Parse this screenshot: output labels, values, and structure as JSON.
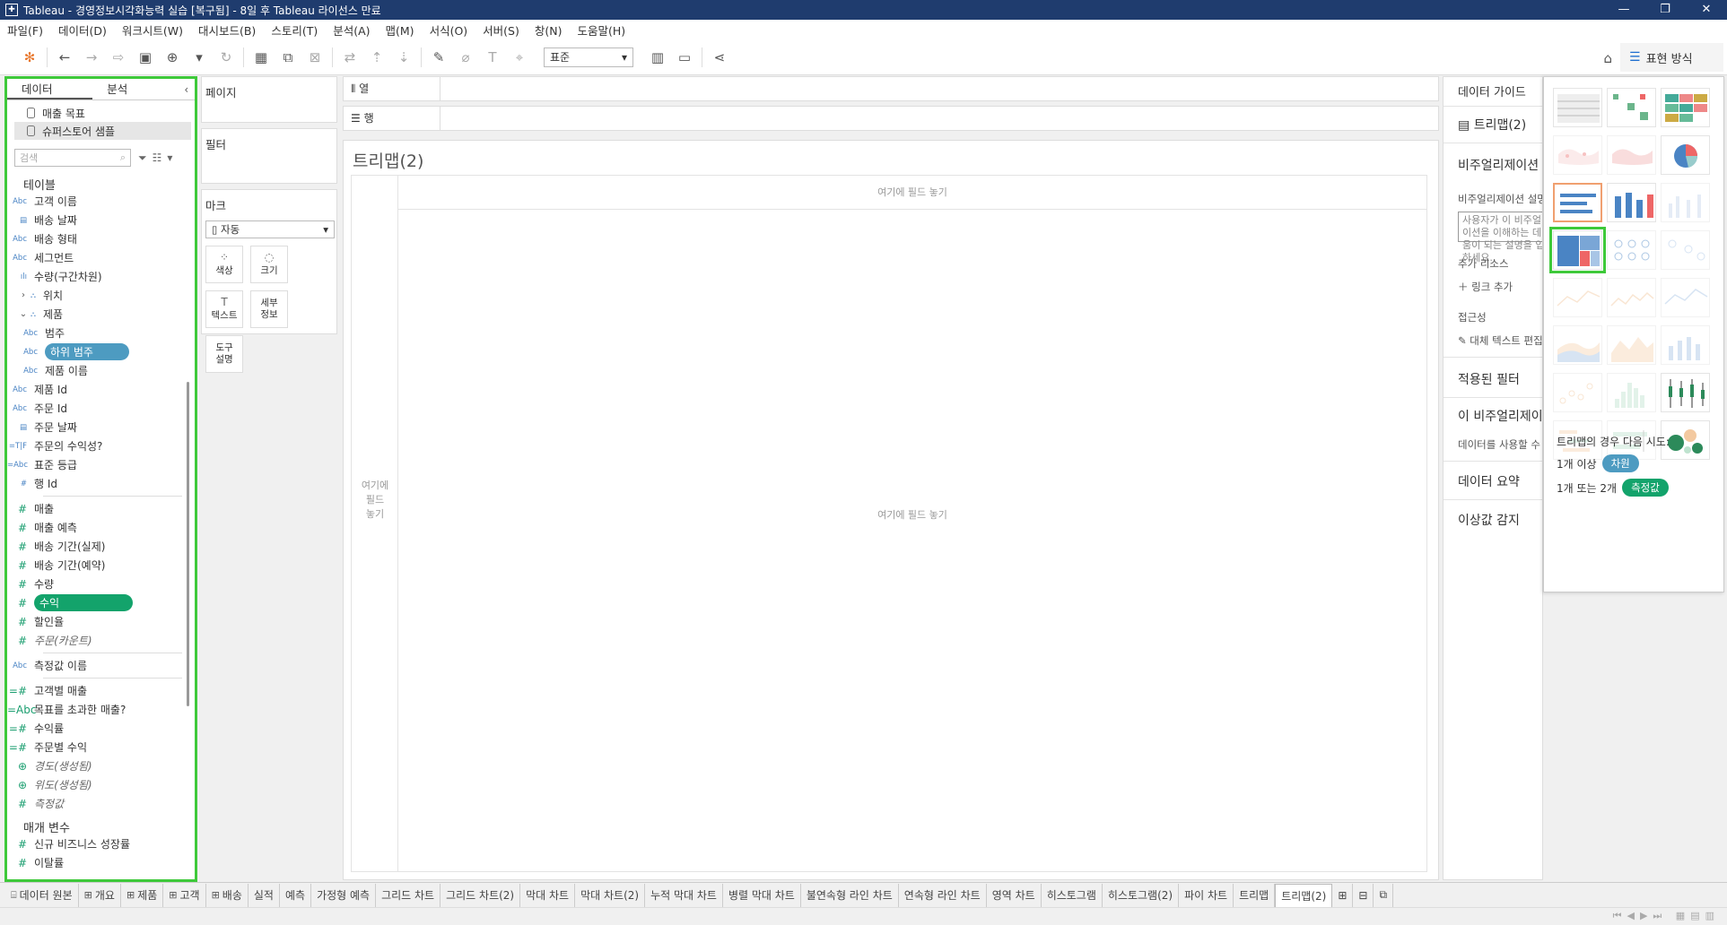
{
  "window": {
    "title": "Tableau - 경영정보시각화능력 실습 [복구됨] - 8일 후 Tableau 라이선스 만료",
    "controls": [
      "—",
      "❐",
      "✕"
    ]
  },
  "menu": [
    "파일(F)",
    "데이터(D)",
    "워크시트(W)",
    "대시보드(B)",
    "스토리(T)",
    "분석(A)",
    "맵(M)",
    "서식(O)",
    "서버(S)",
    "창(N)",
    "도움말(H)"
  ],
  "toolbar": {
    "fit_select": "표준",
    "show_me_label": "표현 방식"
  },
  "data_pane": {
    "tabs": [
      "데이터",
      "분석"
    ],
    "datasources": [
      "매출 목표",
      "슈퍼스토어 샘플"
    ],
    "search_placeholder": "검색",
    "tables_header": "테이블",
    "dimensions": [
      {
        "type": "Abc",
        "label": "고객 이름"
      },
      {
        "type": "▤",
        "label": "배송 날짜"
      },
      {
        "type": "Abc",
        "label": "배송 형태"
      },
      {
        "type": "Abc",
        "label": "세그먼트"
      },
      {
        "type": "ılı",
        "label": "수량(구간차원)"
      },
      {
        "type": "⛬",
        "label": "위치",
        "caret": "›"
      },
      {
        "type": "⛬",
        "label": "제품",
        "caret": "⌄"
      },
      {
        "type": "Abc",
        "label": "범주",
        "indent": true
      },
      {
        "type": "Abc",
        "label": "하위 범주",
        "indent": true,
        "pill": "blue"
      },
      {
        "type": "Abc",
        "label": "제품 이름",
        "indent": true
      },
      {
        "type": "Abc",
        "label": "제품 Id"
      },
      {
        "type": "Abc",
        "label": "주문 Id"
      },
      {
        "type": "▤",
        "label": "주문 날짜"
      },
      {
        "type": "=T|F",
        "label": "주문의 수익성?"
      },
      {
        "type": "=Abc",
        "label": "표준 등급"
      },
      {
        "type": "#",
        "label": "행 Id"
      }
    ],
    "measures": [
      {
        "label": "매출"
      },
      {
        "label": "매출 예측"
      },
      {
        "label": "배송 기간(실제)"
      },
      {
        "label": "배송 기간(예약)"
      },
      {
        "label": "수량"
      },
      {
        "label": "수익",
        "pill": "green"
      },
      {
        "label": "할인율"
      },
      {
        "label": "주문(카운트)",
        "italic": true
      }
    ],
    "measure_names": {
      "type": "Abc",
      "label": "측정값 이름"
    },
    "calcs": [
      {
        "type": "=#",
        "label": "고객별 매출"
      },
      {
        "type": "=Abc",
        "label": "목표를 초과한 매출?"
      },
      {
        "type": "=#",
        "label": "수익률"
      },
      {
        "type": "=#",
        "label": "주문별 수익"
      },
      {
        "type": "⊕",
        "label": "경도(생성됨)",
        "italic": true
      },
      {
        "type": "⊕",
        "label": "위도(생성됨)",
        "italic": true
      },
      {
        "type": "#",
        "label": "측정값",
        "italic": true
      }
    ],
    "params_header": "매개 변수",
    "params": [
      {
        "type": "#",
        "label": "신규 비즈니스 성장률"
      },
      {
        "type": "#",
        "label": "이탈률"
      }
    ]
  },
  "shelves": {
    "pages": "페이지",
    "filters": "필터",
    "marks": "마크",
    "mark_type": "자동",
    "mark_buttons": [
      {
        "icon": "⁘",
        "label": "색상"
      },
      {
        "icon": "◌",
        "label": "크기"
      },
      {
        "icon": "T",
        "label": "텍스트"
      },
      {
        "icon": "",
        "label": "세부\n정보"
      },
      {
        "icon": "",
        "label": "도구\n설명"
      }
    ],
    "columns": "열",
    "rows": "행"
  },
  "view": {
    "title": "트리맵(2)",
    "drop_top": "여기에 필드 놓기",
    "drop_left": "여기에\n필드\n놓기",
    "drop_center": "여기에 필드 놓기"
  },
  "data_guide": {
    "header": "데이터 가이드",
    "sheet": "트리맵(2)",
    "viz_desc_header": "비주얼리제이션 설명",
    "viz_desc_label": "비주얼리제이션 설명",
    "viz_desc_box": "사용자가 이 비주얼리제이션을 이해하는 데 도움이 되는 설명을 입력하세요.",
    "resources": "추가 리소스",
    "add_link": "링크 추가",
    "accessibility": "접근성",
    "alt_text": "대체 텍스트 편집",
    "applied_filters": "적용된 필터",
    "this_viz": "이 비주얼리제이션",
    "this_viz_sub": "데이터를 사용할 수 있음",
    "data_summary": "데이터 요약",
    "outliers": "이상값 감지"
  },
  "show_me": {
    "hint": "트리맵의 경우 다음 시도:",
    "req1_prefix": "1개 이상",
    "req1_pill": "차원",
    "req2_prefix": "1개 또는 2개",
    "req2_pill": "측정값",
    "pill_blue": "#4d9bc1",
    "pill_green": "#13a36b"
  },
  "sheet_tabs": [
    "데이터 원본",
    "개요",
    "제품",
    "고객",
    "배송",
    "실적",
    "예측",
    "가정형 예측",
    "그리드 차트",
    "그리드 차트(2)",
    "막대 차트",
    "막대 차트(2)",
    "누적 막대 차트",
    "병렬 막대 차트",
    "불연속형 라인 차트",
    "연속형 라인 차트",
    "영역 차트",
    "히스토그램",
    "히스토그램(2)",
    "파이 차트",
    "트리맵",
    "트리맵(2)"
  ],
  "colors": {
    "highlight": "#3ec93a",
    "titlebar": "#1f3c6e"
  }
}
